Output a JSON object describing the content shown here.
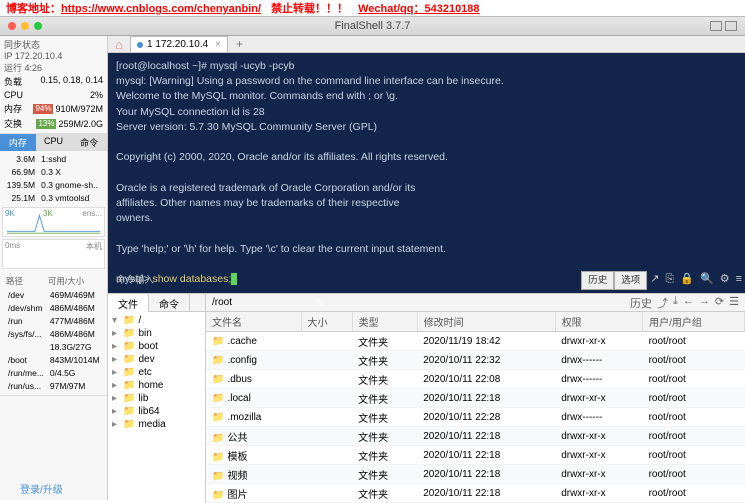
{
  "banner": {
    "blog_label": "博客地址：",
    "blog_url": "https://www.cnblogs.com/chenyanbin/",
    "forbid": "禁止转载！！！",
    "contact_label": "Wechat/qq：543210188"
  },
  "window": {
    "title": "FinalShell 3.7.7"
  },
  "sidebar": {
    "sync": "同步状态",
    "ip": "IP 172.20.10.4",
    "runtime": "运行 4:26",
    "load_label": "负载",
    "load": "0.15, 0.18, 0.14",
    "cpu_label": "CPU",
    "cpu_pct": "2%",
    "mem_label": "内存",
    "mem_pct": "94%",
    "mem_val": "910M/972M",
    "swap_label": "交换",
    "swap_pct": "13%",
    "swap_val": "259M/2.0G",
    "tabs": [
      "内存",
      "CPU",
      "命令"
    ],
    "procs": [
      {
        "v": "3.6M",
        "n": "1:sshd"
      },
      {
        "v": "66.9M",
        "n": "0.3 X"
      },
      {
        "v": "139.5M",
        "n": "0.3 gnome-sh.."
      },
      {
        "v": "25.1M",
        "n": "0.3 vmtoolsd"
      }
    ],
    "chart_legend_l": "9K",
    "chart_legend_r": "3K",
    "chart_legend_rx": "ens...",
    "chart_bottom_l": "0ms",
    "chart_bottom_r": "本机",
    "disk_hdr": [
      "路径",
      "可用/大小"
    ],
    "disks": [
      {
        "p": "/dev",
        "s": "469M/469M"
      },
      {
        "p": "/dev/shm",
        "s": "486M/486M"
      },
      {
        "p": "/run",
        "s": "477M/486M"
      },
      {
        "p": "/sys/fs/...",
        "s": "486M/486M"
      },
      {
        "p": "",
        "s": "18.3G/27G"
      },
      {
        "p": "/boot",
        "s": "843M/1014M"
      },
      {
        "p": "/run/me...",
        "s": "0/4.5G"
      },
      {
        "p": "/run/us...",
        "s": "97M/97M"
      }
    ],
    "upgrade": "登录/升级"
  },
  "tab": {
    "label": "1 172.20.10.4"
  },
  "terminal": {
    "lines": [
      "[root@localhost ~]# mysql -ucyb -pcyb",
      "mysql: [Warning] Using a password on the command line interface can be insecure.",
      "Welcome to the MySQL monitor.  Commands end with ; or \\g.",
      "Your MySQL connection id is 28",
      "Server version: 5.7.30 MySQL Community Server (GPL)",
      "",
      "Copyright (c) 2000, 2020, Oracle and/or its affiliates. All rights reserved.",
      "",
      "Oracle is a registered trademark of Oracle Corporation and/or its",
      "affiliates. Other names may be trademarks of their respective",
      "owners.",
      "",
      "Type 'help;' or '\\h' for help. Type '\\c' to clear the current input statement.",
      ""
    ],
    "prompt": "mysql> ",
    "cmd": "show databases;",
    "footer_label": "命令输入",
    "history": "历史",
    "options": "选项"
  },
  "fb": {
    "tabs": [
      "文件",
      "命令"
    ],
    "path": "/root",
    "history": "历史",
    "tree": [
      "/",
      "bin",
      "boot",
      "dev",
      "etc",
      "home",
      "lib",
      "lib64",
      "media"
    ],
    "hdr": [
      "文件名",
      "大小",
      "类型",
      "修改时间",
      "权限",
      "用户/用户组"
    ],
    "rows": [
      {
        "n": ".cache",
        "t": "文件夹",
        "m": "2020/11/19 18:42",
        "p": "drwxr-xr-x",
        "u": "root/root"
      },
      {
        "n": ".config",
        "t": "文件夹",
        "m": "2020/10/11 22:32",
        "p": "drwx------",
        "u": "root/root"
      },
      {
        "n": ".dbus",
        "t": "文件夹",
        "m": "2020/10/11 22:08",
        "p": "drwx------",
        "u": "root/root"
      },
      {
        "n": ".local",
        "t": "文件夹",
        "m": "2020/10/11 22:18",
        "p": "drwxr-xr-x",
        "u": "root/root"
      },
      {
        "n": ".mozilla",
        "t": "文件夹",
        "m": "2020/10/11 22:28",
        "p": "drwx------",
        "u": "root/root"
      },
      {
        "n": "公共",
        "t": "文件夹",
        "m": "2020/10/11 22:18",
        "p": "drwxr-xr-x",
        "u": "root/root"
      },
      {
        "n": "模板",
        "t": "文件夹",
        "m": "2020/10/11 22:18",
        "p": "drwxr-xr-x",
        "u": "root/root"
      },
      {
        "n": "视频",
        "t": "文件夹",
        "m": "2020/10/11 22:18",
        "p": "drwxr-xr-x",
        "u": "root/root"
      },
      {
        "n": "图片",
        "t": "文件夹",
        "m": "2020/10/11 22:18",
        "p": "drwxr-xr-x",
        "u": "root/root"
      }
    ]
  }
}
